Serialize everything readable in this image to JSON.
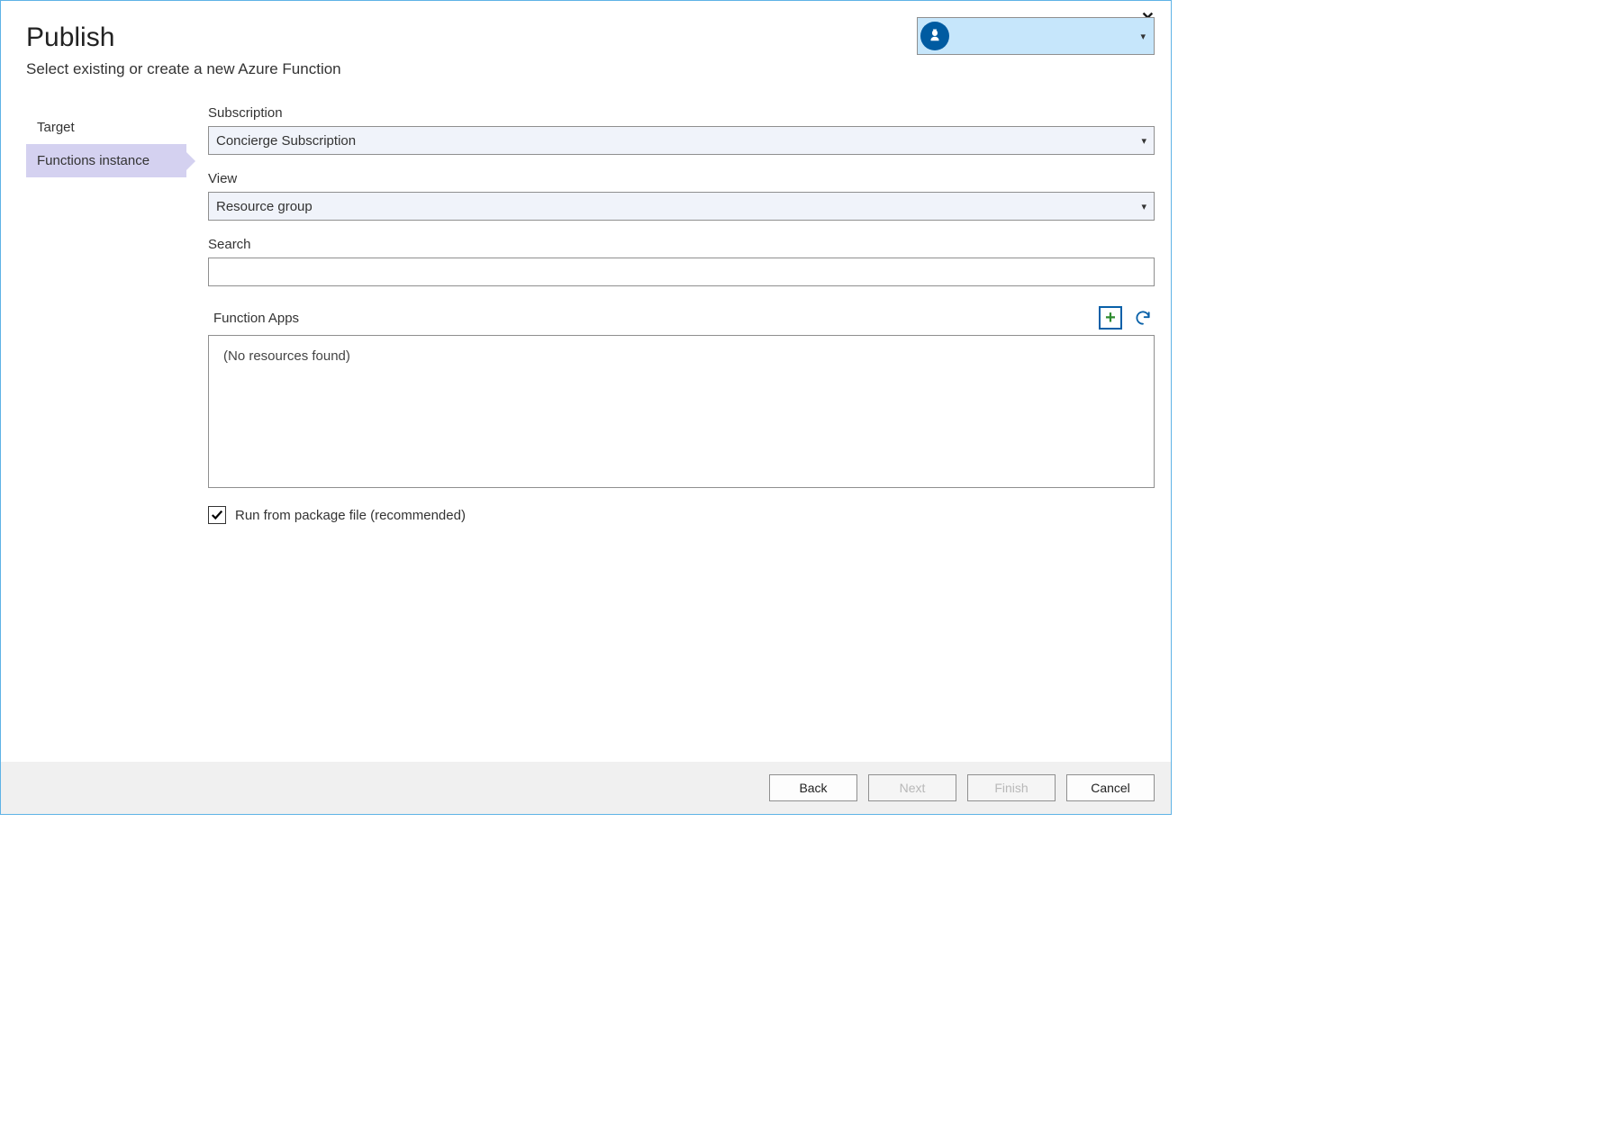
{
  "dialog": {
    "title": "Publish",
    "subtitle": "Select existing or create a new Azure Function",
    "close_symbol": "✕"
  },
  "nav": {
    "items": [
      {
        "label": "Target",
        "selected": false
      },
      {
        "label": "Functions instance",
        "selected": true
      }
    ]
  },
  "form": {
    "subscription": {
      "label": "Subscription",
      "value": "Concierge Subscription"
    },
    "view": {
      "label": "View",
      "value": "Resource group"
    },
    "search": {
      "label": "Search",
      "value": ""
    },
    "function_apps": {
      "label": "Function Apps",
      "empty_text": "(No resources found)"
    },
    "run_from_package": {
      "label": "Run from package file (recommended)",
      "checked": true
    }
  },
  "icons": {
    "add": "+",
    "caret": "▾"
  },
  "footer": {
    "back": "Back",
    "next": "Next",
    "finish": "Finish",
    "cancel": "Cancel"
  }
}
